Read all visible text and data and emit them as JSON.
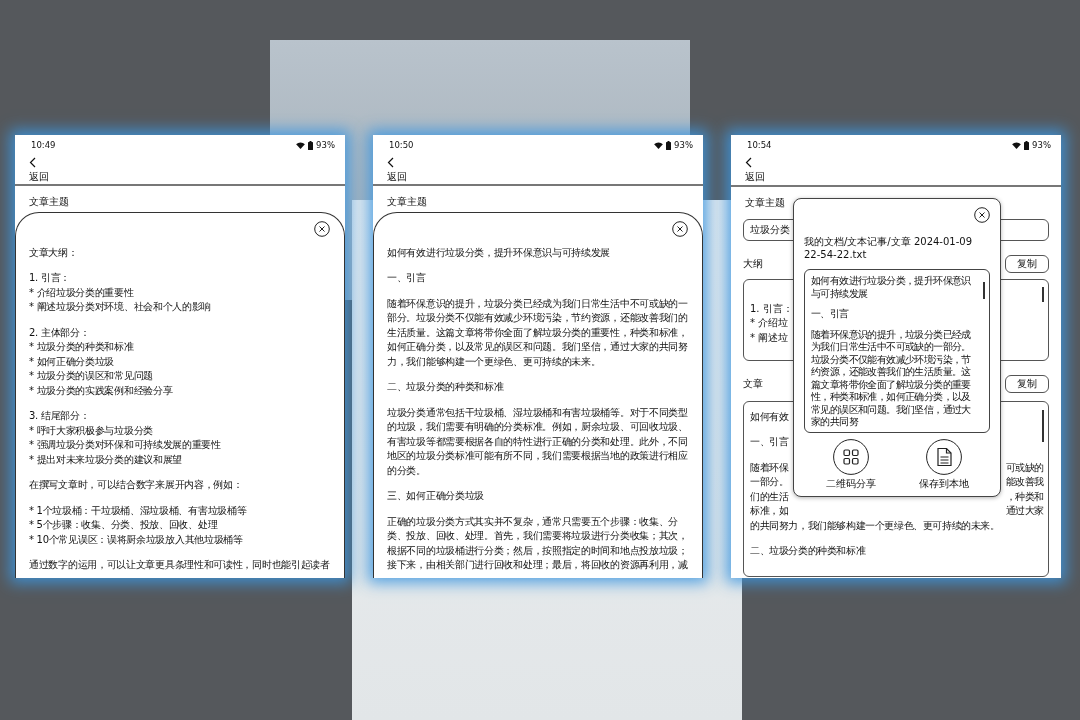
{
  "panels": [
    {
      "kind": "outline",
      "time": "10:49",
      "battery": "93%",
      "back": "返回",
      "topic_label": "文章主题",
      "blocks": [
        [
          "文章大纲："
        ],
        [
          "1. 引言：",
          "* 介绍垃圾分类的重要性",
          "* 阐述垃圾分类对环境、社会和个人的影响"
        ],
        [
          "2. 主体部分：",
          "* 垃圾分类的种类和标准",
          "* 如何正确分类垃圾",
          "* 垃圾分类的误区和常见问题",
          "* 垃圾分类的实践案例和经验分享"
        ],
        [
          "3. 结尾部分：",
          "* 呼吁大家积极参与垃圾分类",
          "* 强调垃圾分类对环保和可持续发展的重要性",
          "* 提出对未来垃圾分类的建议和展望"
        ],
        [
          "在撰写文章时，可以结合数字来展开内容，例如："
        ],
        [
          "* 1个垃圾桶：干垃圾桶、湿垃圾桶、有害垃圾桶等",
          "* 5个步骤：收集、分类、投放、回收、处理",
          "* 10个常见误区：误将厨余垃圾放入其他垃圾桶等"
        ],
        [
          "通过数字的运用，可以让文章更具条理性和可读性，同时也能引起读者"
        ]
      ]
    },
    {
      "kind": "article",
      "time": "10:50",
      "battery": "93%",
      "back": "返回",
      "topic_label": "文章主题",
      "paragraphs": [
        "如何有效进行垃圾分类，提升环保意识与可持续发展",
        "一、引言",
        "随着环保意识的提升，垃圾分类已经成为我们日常生活中不可或缺的一部分。垃圾分类不仅能有效减少环境污染，节约资源，还能改善我们的生活质量。这篇文章将带你全面了解垃圾分类的重要性，种类和标准，如何正确分类，以及常见的误区和问题。我们坚信，通过大家的共同努力，我们能够构建一个更绿色、更可持续的未来。",
        "二、垃圾分类的种类和标准",
        "垃圾分类通常包括干垃圾桶、湿垃圾桶和有害垃圾桶等。对于不同类型的垃圾，我们需要有明确的分类标准。例如，厨余垃圾、可回收垃圾、有害垃圾等都需要根据各自的特性进行正确的分类和处理。此外，不同地区的垃圾分类标准可能有所不同，我们需要根据当地的政策进行相应的分类。",
        "三、如何正确分类垃圾",
        "正确的垃圾分类方式其实并不复杂，通常只需要五个步骤：收集、分类、投放、回收、处理。首先，我们需要将垃圾进行分类收集；其次，根据不同的垃圾桶进行分类；然后，按照指定的时间和地点投放垃圾；接下来，由相关部门进行回收和处理；最后，将回收的资源再利用，减"
      ]
    },
    {
      "kind": "editor",
      "time": "10:54",
      "battery": "93%",
      "back": "返回",
      "topic_label": "文章主题",
      "topic_value": "垃圾分类",
      "outline": {
        "label": "大纲",
        "copy": "复制",
        "lines": [
          "1. 引言：",
          "* 介绍垃",
          "* 阐述垃"
        ]
      },
      "article": {
        "label": "文章",
        "copy": "复制",
        "blocks": [
          [
            {
              "left": "如何有效"
            }
          ],
          [
            {
              "left": "一、引言"
            }
          ],
          [
            {
              "left": "随着环保",
              "right": "可或缺的"
            },
            {
              "left": "一部分。",
              "right": "能改善我"
            },
            {
              "left": "们的生活",
              "right": "，种类和"
            },
            {
              "left": "标准，如",
              "right": "通过大家"
            },
            {
              "left": "的共同努力，我们能够构建一个更绿色、更可持续的未来。"
            }
          ],
          [
            {
              "left": "二、垃圾分类的种类和标准"
            }
          ]
        ]
      },
      "dialog": {
        "path": "我的文档/文本记事/文章 2024-01-09 22-54-22.txt",
        "paragraphs": [
          "如何有效进行垃圾分类，提升环保意识与可持续发展",
          "一、引言",
          "随着环保意识的提升，垃圾分类已经成为我们日常生活中不可或缺的一部分。垃圾分类不仅能有效减少环境污染，节约资源，还能改善我们的生活质量。这篇文章将带你全面了解垃圾分类的重要性，种类和标准，如何正确分类，以及常见的误区和问题。我们坚信，通过大家的共同努"
        ],
        "actions": [
          {
            "kind": "qr",
            "label": "二维码分享"
          },
          {
            "kind": "save",
            "label": "保存到本地"
          }
        ]
      }
    }
  ]
}
